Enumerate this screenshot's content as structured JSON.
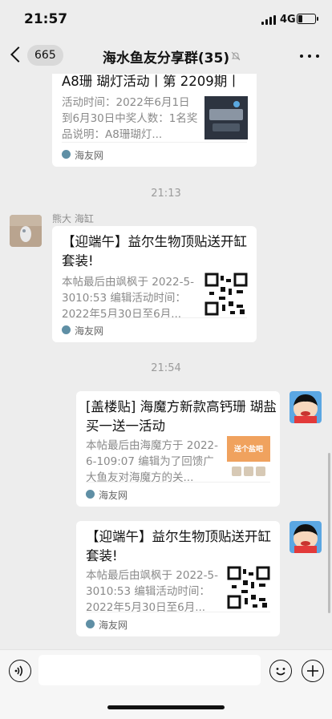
{
  "status": {
    "time": "21:57",
    "network": "4G"
  },
  "nav": {
    "back_count": "665",
    "title": "海水鱼友分享群(35)"
  },
  "messages": [
    {
      "title": "A8珊 瑚灯活动丨第 2209期丨",
      "desc": "活动时间：2022年6月1日到6月30日中奖人数：1名奖品说明：A8珊瑚灯...",
      "source": "海友网"
    },
    {
      "timestamp": "21:13",
      "sender": "熊大 海缸",
      "title": "【迎端午】益尔生物顶贴送开缸套装!",
      "desc": "本帖最后由飒枫于 2022-5-3010:53 编辑活动时间：2022年5月30日至6月...",
      "source": "海友网"
    },
    {
      "timestamp": "21:54",
      "title": "[盖楼贴] 海魔方新款高钙珊 瑚盐买一送一活动",
      "desc": "本帖最后由海魔方于 2022-6-109:07 编辑为了回馈广大鱼友对海魔方的关...",
      "source": "海友网",
      "thumb_text": "送个盐吧"
    },
    {
      "title": "【迎端午】益尔生物顶贴送开缸套装!",
      "desc": "本帖最后由飒枫于 2022-5-3010:53 编辑活动时间：2022年5月30日至6月...",
      "source": "海友网"
    }
  ],
  "colors": {
    "background": "#ededed",
    "card": "#ffffff",
    "muted": "#8a8a8a"
  }
}
